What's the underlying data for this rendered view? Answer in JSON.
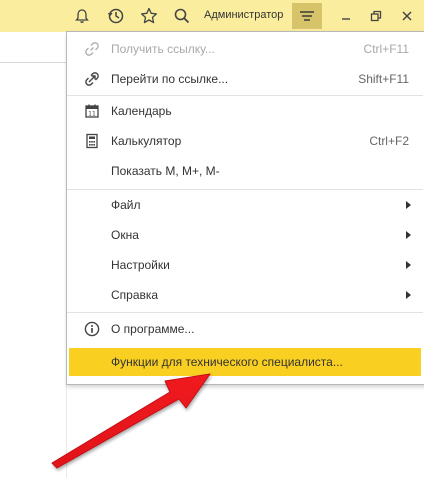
{
  "toolbar": {
    "user_name": "Администратор"
  },
  "menu": {
    "get_link": {
      "label": "Получить ссылку...",
      "shortcut": "Ctrl+F11"
    },
    "go_to_link": {
      "label": "Перейти по ссылке...",
      "shortcut": "Shift+F11"
    },
    "calendar": {
      "label": "Календарь"
    },
    "calculator": {
      "label": "Калькулятор",
      "shortcut": "Ctrl+F2"
    },
    "show_m": {
      "label": "Показать М, М+, М-"
    },
    "file": {
      "label": "Файл"
    },
    "windows": {
      "label": "Окна"
    },
    "settings": {
      "label": "Настройки"
    },
    "help": {
      "label": "Справка"
    },
    "about": {
      "label": "О программе..."
    },
    "tech_specialist": {
      "label": "Функции для технического специалиста..."
    }
  },
  "colors": {
    "titlebar_bg": "#fbed9e",
    "menu_button_active": "#d7c36a",
    "highlight": "#f9cf22",
    "annotation_arrow": "#e8141b"
  }
}
